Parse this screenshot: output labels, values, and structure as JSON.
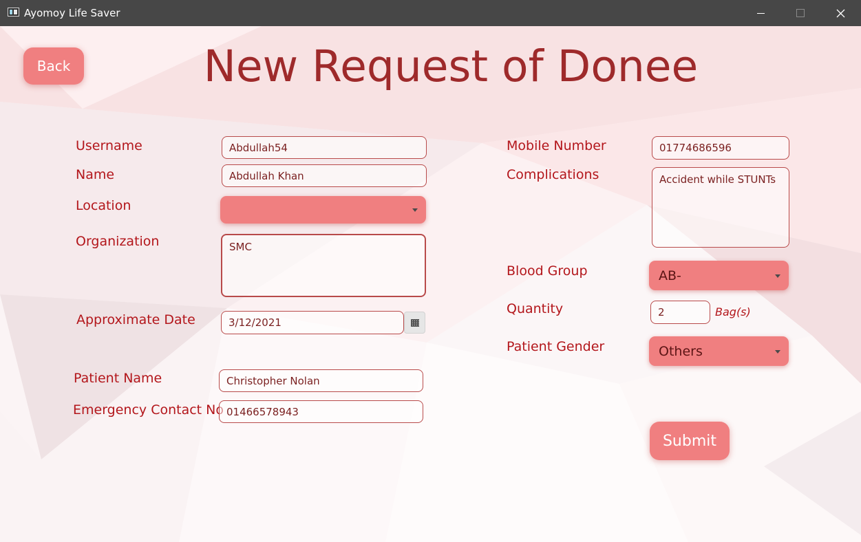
{
  "window": {
    "title": "Ayomoy Life Saver"
  },
  "page": {
    "title": "New Request of Donee",
    "back_label": "Back",
    "submit_label": "Submit"
  },
  "form": {
    "username": {
      "label": "Username",
      "value": "Abdullah54"
    },
    "name": {
      "label": "Name",
      "value": "Abdullah Khan"
    },
    "location": {
      "label": "Location",
      "value": ""
    },
    "organization": {
      "label": "Organization",
      "value": "SMC"
    },
    "approximate_date": {
      "label": "Approximate Date",
      "value": "3/12/2021"
    },
    "patient_name": {
      "label": "Patient Name",
      "value": "Christopher Nolan"
    },
    "emergency_contact": {
      "label": "Emergency Contact No",
      "value": "01466578943"
    },
    "mobile_number": {
      "label": "Mobile Number",
      "value": "01774686596"
    },
    "complications": {
      "label": "Complications",
      "value": "Accident while STUNTs"
    },
    "blood_group": {
      "label": "Blood Group",
      "value": "AB-"
    },
    "quantity": {
      "label": "Quantity",
      "value": "2",
      "unit": "Bag(s)"
    },
    "patient_gender": {
      "label": "Patient Gender",
      "value": "Others"
    }
  },
  "colors": {
    "accent": "#f07f80",
    "label": "#b3161b",
    "heading": "#9e2a2b",
    "titlebar": "#474747"
  },
  "icons": [
    "app-icon",
    "minimize-icon",
    "maximize-icon",
    "close-icon",
    "chevron-down-icon",
    "calendar-icon"
  ]
}
